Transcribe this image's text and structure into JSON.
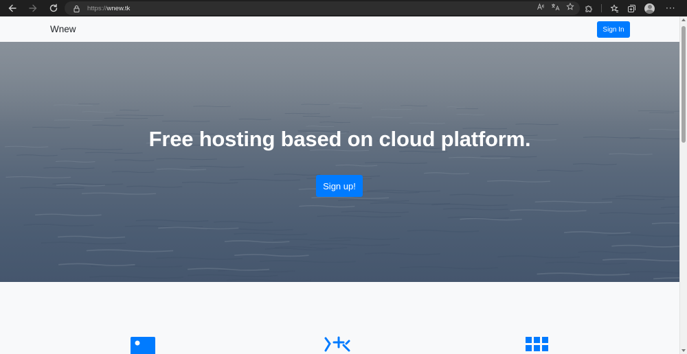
{
  "browser": {
    "url_scheme": "https://",
    "url_host": "wnew.tk"
  },
  "site": {
    "brand": "Wnew",
    "signin_label": "Sign In"
  },
  "hero": {
    "title": "Free hosting based on cloud platform.",
    "signup_label": "Sign up!"
  },
  "features": {
    "icons": [
      "id-card-icon",
      "rocket-icon",
      "grid-icon"
    ]
  },
  "colors": {
    "primary": "#007bff",
    "chrome_bg": "#1f1f1f",
    "page_bg": "#f8f9fa"
  }
}
